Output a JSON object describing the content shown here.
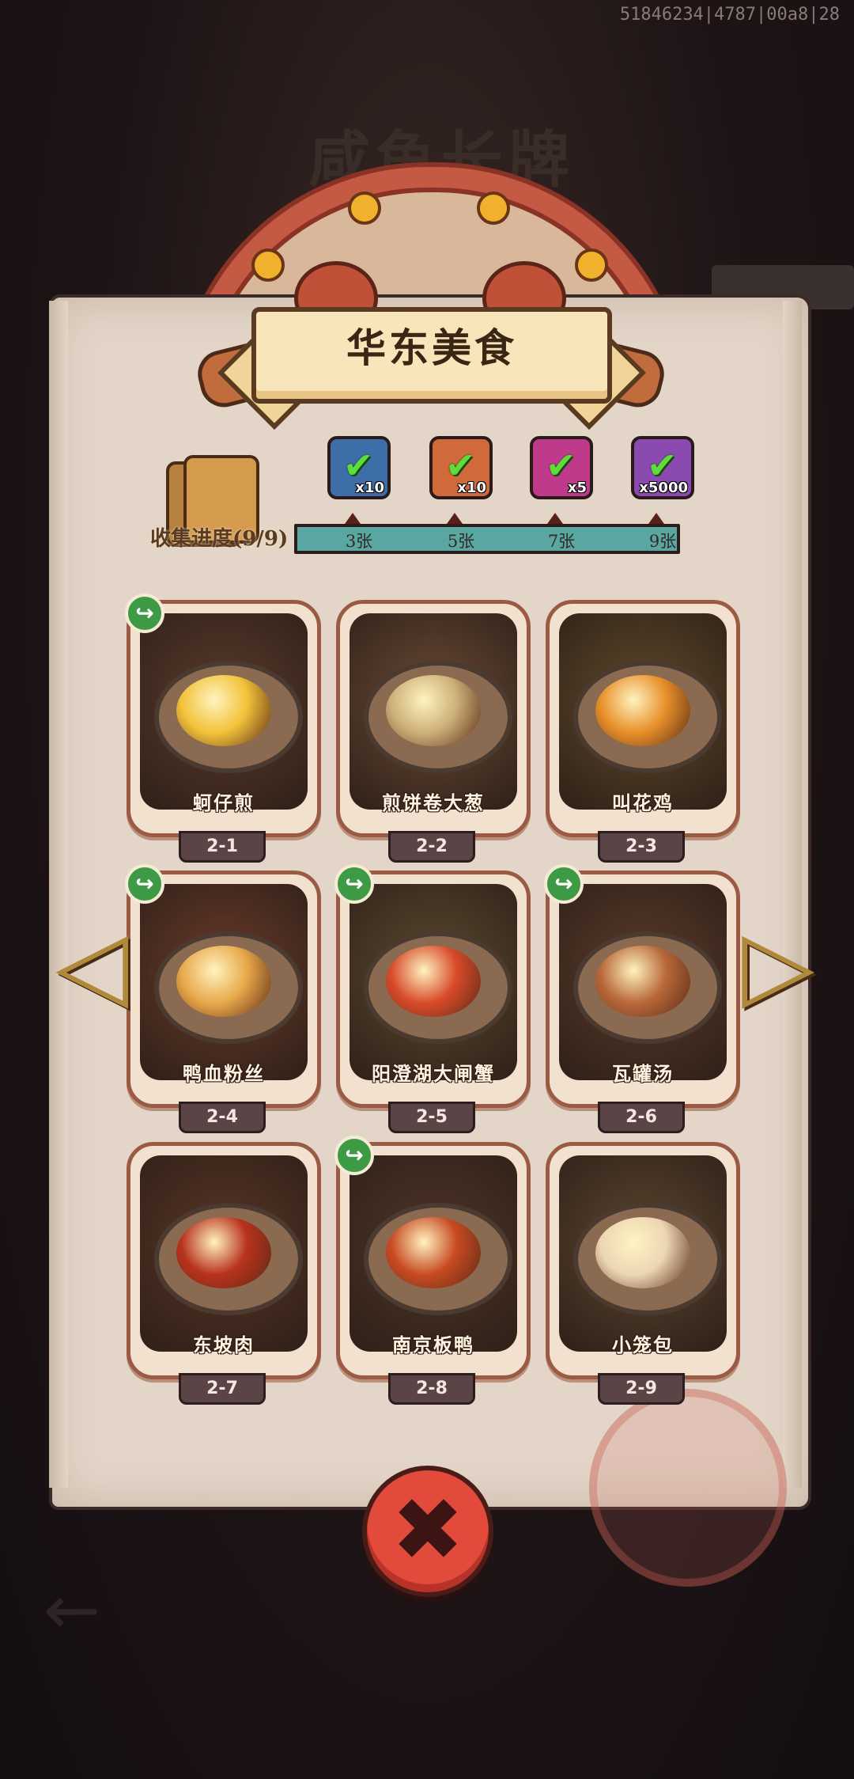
{
  "debug_id": "51846234|4787|00a8|28",
  "background": {
    "ghost_title": "咸鱼长牌"
  },
  "title": "华东美食",
  "collection": {
    "progress_label": "收集进度(9/9)",
    "ticks": [
      "3张",
      "5张",
      "7张",
      "9张"
    ],
    "progress": 1.0,
    "rewards": [
      {
        "icon": "chest-icon",
        "qty": "x10",
        "claimed": true,
        "color": "#3e6ea8"
      },
      {
        "icon": "hammer-icon",
        "qty": "x10",
        "claimed": true,
        "color": "#d06a3a"
      },
      {
        "icon": "gem-icon",
        "qty": "x5",
        "claimed": true,
        "color": "#c03a8c"
      },
      {
        "icon": "crystal-icon",
        "qty": "x5000",
        "claimed": true,
        "color": "#8a4ab0"
      }
    ]
  },
  "dishes": [
    {
      "name": "蚵仔煎",
      "tag": "2-1",
      "share": true,
      "bg": "#5a3a2c",
      "food": "#f2c33a"
    },
    {
      "name": "煎饼卷大葱",
      "tag": "2-2",
      "share": false,
      "bg": "#6a4a36",
      "food": "#cdb07a"
    },
    {
      "name": "叫花鸡",
      "tag": "2-3",
      "share": false,
      "bg": "#5e4a2a",
      "food": "#e8902a"
    },
    {
      "name": "鸭血粉丝",
      "tag": "2-4",
      "share": true,
      "bg": "#6a3a2a",
      "food": "#e8a84a"
    },
    {
      "name": "阳澄湖大闸蟹",
      "tag": "2-5",
      "share": true,
      "bg": "#5a4a30",
      "food": "#d84a2a"
    },
    {
      "name": "瓦罐汤",
      "tag": "2-6",
      "share": true,
      "bg": "#5a3a2a",
      "food": "#b8683a"
    },
    {
      "name": "东坡肉",
      "tag": "2-7",
      "share": false,
      "bg": "#5a3426",
      "food": "#b8321e"
    },
    {
      "name": "南京板鸭",
      "tag": "2-8",
      "share": true,
      "bg": "#4e3428",
      "food": "#c84a22"
    },
    {
      "name": "小笼包",
      "tag": "2-9",
      "share": false,
      "bg": "#5a4630",
      "food": "#ecd6b4"
    }
  ],
  "icons": {
    "share": "share-icon",
    "prev": "arrow-left-icon",
    "next": "arrow-right-icon",
    "close": "close-icon"
  },
  "glyphs": {
    "prev": "◁",
    "next": "▷",
    "close": "✖",
    "share": "↪",
    "check": "✔"
  }
}
